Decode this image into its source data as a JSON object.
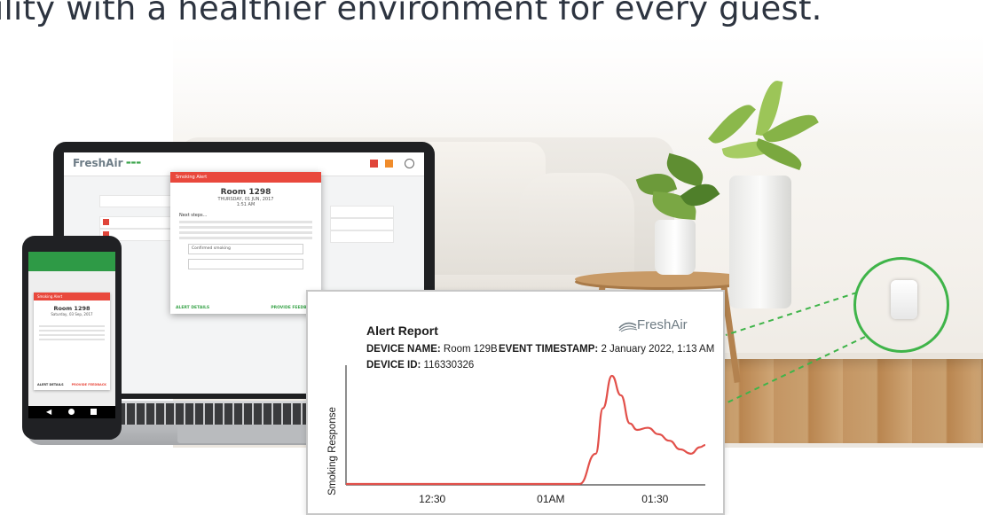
{
  "headline": "ility with a healthier environment for every guest.",
  "laptop": {
    "brand": "FreshAir",
    "modal": {
      "header": "Smoking Alert",
      "title": "Room 1298",
      "date": "THURSDAY, 01 JUN, 2017",
      "time": "1:51 AM",
      "next_steps": "Next steps...",
      "select_value": "Confirmed smoking",
      "footer_left": "ALERT DETAILS",
      "footer_right": "PROVIDE FEEDBACK"
    }
  },
  "phone": {
    "card_header": "Smoking Alert",
    "card_title": "Room 1298",
    "card_date": "Saturday, 03 Sep, 2017",
    "footer_left": "ALERT DETAILS",
    "footer_right": "PROVIDE FEEDBACK"
  },
  "report": {
    "title": "Alert Report",
    "logo_text": "FreshAir",
    "device_name_label": "DEVICE NAME:",
    "device_name_value": "Room 129B",
    "event_timestamp_label": "EVENT TIMESTAMP:",
    "event_timestamp_value": "2 January 2022, 1:13 AM",
    "device_id_label": "DEVICE ID:",
    "device_id_value": "116330326"
  },
  "colors": {
    "accent_green": "#3fb449",
    "alert_red": "#e9483c",
    "series_red": "#e2504a"
  },
  "chart_data": {
    "type": "line",
    "ylabel": "Smoking Response",
    "xlabel": "",
    "x_ticks": [
      "12:30",
      "01AM",
      "01:30"
    ],
    "series": [
      {
        "x": [
          0,
          0.65,
          0.695,
          0.715,
          0.74,
          0.765,
          0.79,
          0.81,
          0.84,
          0.87,
          0.9,
          0.93,
          0.96,
          0.985,
          1.0
        ],
        "values": [
          0.0,
          0.0,
          0.28,
          0.7,
          1.0,
          0.82,
          0.56,
          0.5,
          0.52,
          0.46,
          0.4,
          0.32,
          0.28,
          0.34,
          0.36
        ]
      }
    ],
    "grid": false
  }
}
